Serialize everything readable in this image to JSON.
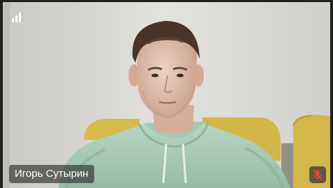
{
  "participant": {
    "name": "Игорь Сутырин",
    "microphone_muted": true
  },
  "icons": {
    "signal": "signal-strength-icon",
    "mic": "mic-muted-icon"
  },
  "colors": {
    "wall": "#dcdad4",
    "hoodie": "#a9cbb8",
    "armchair": "#d4b84a",
    "mute_red": "#e5493c"
  }
}
